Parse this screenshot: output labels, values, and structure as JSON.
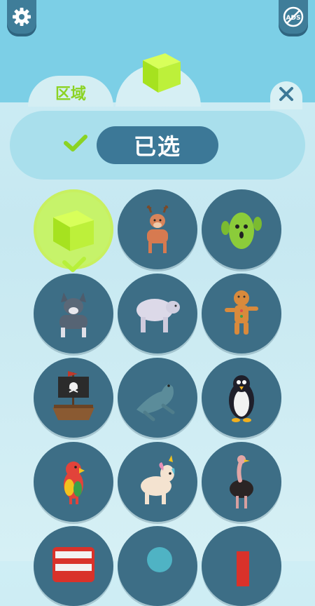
{
  "tabs": [
    {
      "label": "区域"
    },
    {
      "label": ""
    }
  ],
  "header": {
    "selected_label": "已选"
  },
  "icons": {
    "settings": "gear-icon",
    "no_ads": "no-ads-icon",
    "no_ads_text": "ADS",
    "close": "close-icon",
    "check": "checkmark-icon"
  },
  "colors": {
    "accent_green": "#b7f03a",
    "panel_dark": "#3c7897",
    "circle_bg": "#3d6e86",
    "top_bar": "#7ccfe6"
  },
  "skins": [
    {
      "name": "cube",
      "selected": true
    },
    {
      "name": "deer",
      "selected": false
    },
    {
      "name": "cactus",
      "selected": false
    },
    {
      "name": "wolf",
      "selected": false
    },
    {
      "name": "polar-bear",
      "selected": false
    },
    {
      "name": "gingerbread-man",
      "selected": false
    },
    {
      "name": "pirate-ship",
      "selected": false
    },
    {
      "name": "seal",
      "selected": false
    },
    {
      "name": "penguin",
      "selected": false
    },
    {
      "name": "parrot",
      "selected": false
    },
    {
      "name": "unicorn",
      "selected": false
    },
    {
      "name": "ostrich",
      "selected": false
    },
    {
      "name": "double-decker-bus",
      "selected": false
    },
    {
      "name": "ball",
      "selected": false
    },
    {
      "name": "red-block",
      "selected": false
    }
  ]
}
